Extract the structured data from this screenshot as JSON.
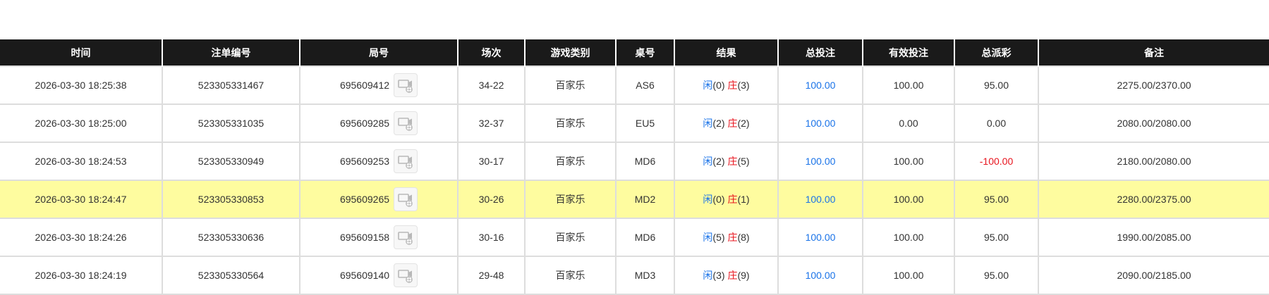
{
  "table": {
    "headers": [
      "时间",
      "注单编号",
      "局号",
      "场次",
      "游戏类别",
      "桌号",
      "结果",
      "总投注",
      "有效投注",
      "总派彩",
      "备注"
    ],
    "rows": [
      {
        "time": "2026-03-30 18:25:38",
        "bet_id": "523305331467",
        "round": "695609412",
        "shoe": "34-22",
        "game": "百家乐",
        "table": "AS6",
        "player_label": "闲",
        "player_score": "(0)",
        "banker_label": "庄",
        "banker_score": "(3)",
        "total_bet": "100.00",
        "valid_bet": "100.00",
        "payout": "95.00",
        "payout_negative": false,
        "note": "2275.00/2370.00",
        "highlight": false
      },
      {
        "time": "2026-03-30 18:25:00",
        "bet_id": "523305331035",
        "round": "695609285",
        "shoe": "32-37",
        "game": "百家乐",
        "table": "EU5",
        "player_label": "闲",
        "player_score": "(2)",
        "banker_label": "庄",
        "banker_score": "(2)",
        "total_bet": "100.00",
        "valid_bet": "0.00",
        "payout": "0.00",
        "payout_negative": false,
        "note": "2080.00/2080.00",
        "highlight": false
      },
      {
        "time": "2026-03-30 18:24:53",
        "bet_id": "523305330949",
        "round": "695609253",
        "shoe": "30-17",
        "game": "百家乐",
        "table": "MD6",
        "player_label": "闲",
        "player_score": "(2)",
        "banker_label": "庄",
        "banker_score": "(5)",
        "total_bet": "100.00",
        "valid_bet": "100.00",
        "payout": "-100.00",
        "payout_negative": true,
        "note": "2180.00/2080.00",
        "highlight": false
      },
      {
        "time": "2026-03-30 18:24:47",
        "bet_id": "523305330853",
        "round": "695609265",
        "shoe": "30-26",
        "game": "百家乐",
        "table": "MD2",
        "player_label": "闲",
        "player_score": "(0)",
        "banker_label": "庄",
        "banker_score": "(1)",
        "total_bet": "100.00",
        "valid_bet": "100.00",
        "payout": "95.00",
        "payout_negative": false,
        "note": "2280.00/2375.00",
        "highlight": true
      },
      {
        "time": "2026-03-30 18:24:26",
        "bet_id": "523305330636",
        "round": "695609158",
        "shoe": "30-16",
        "game": "百家乐",
        "table": "MD6",
        "player_label": "闲",
        "player_score": "(5)",
        "banker_label": "庄",
        "banker_score": "(8)",
        "total_bet": "100.00",
        "valid_bet": "100.00",
        "payout": "95.00",
        "payout_negative": false,
        "note": "1990.00/2085.00",
        "highlight": false
      },
      {
        "time": "2026-03-30 18:24:19",
        "bet_id": "523305330564",
        "round": "695609140",
        "shoe": "29-48",
        "game": "百家乐",
        "table": "MD3",
        "player_label": "闲",
        "player_score": "(3)",
        "banker_label": "庄",
        "banker_score": "(9)",
        "total_bet": "100.00",
        "valid_bet": "100.00",
        "payout": "95.00",
        "payout_negative": false,
        "note": "2090.00/2185.00",
        "highlight": false
      }
    ]
  },
  "colors": {
    "header_bg": "#1a1a1a",
    "highlight_row": "#fefc9f",
    "blue": "#1a73e8",
    "red": "#e8141e"
  },
  "icons": {
    "replay": "video-replay-icon"
  }
}
